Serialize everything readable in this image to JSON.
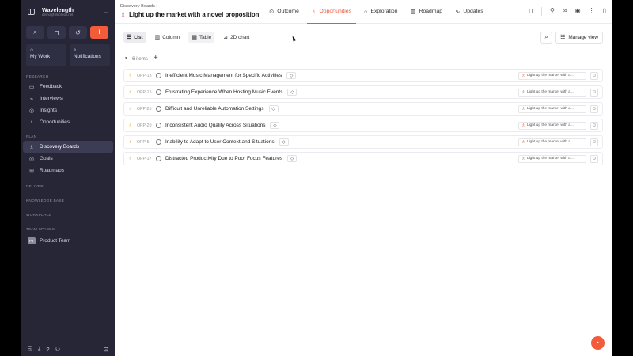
{
  "workspace": {
    "name": "Wavelength",
    "email": "demo@timbreoll.net"
  },
  "sidebar": {
    "quick_icons": [
      "search-icon",
      "bookmark-icon",
      "history-icon",
      "plus-icon"
    ],
    "tiles": [
      {
        "label": "My Work",
        "icon": "inbox-icon"
      },
      {
        "label": "Notifications",
        "icon": "bell-icon"
      }
    ],
    "sections": {
      "research": "RESEARCH",
      "plan": "PLAN",
      "deliver": "DELIVER",
      "knowledge": "KNOWLEDGE BASE",
      "workplace": "WORKPLACE",
      "team": "TEAM SPACES"
    },
    "research_items": [
      "Feedback",
      "Interviews",
      "Insights",
      "Opportunities"
    ],
    "plan_items": [
      "Discovery Boards",
      "Goals",
      "Roadmaps"
    ],
    "team": {
      "badge": "PT",
      "name": "Product Team"
    }
  },
  "header": {
    "breadcrumb": "Discovery Boards",
    "title": "Light up the market with a novel proposition",
    "tabs": [
      "Outcome",
      "Opportunities",
      "Exploration",
      "Roadmap",
      "Updates"
    ],
    "active_tab": "Opportunities"
  },
  "toolbar": {
    "views": [
      "List",
      "Column",
      "Table",
      "2D chart"
    ],
    "active_view": "List",
    "manage_label": "Manage view"
  },
  "group": {
    "count_label": "6 items"
  },
  "items": [
    {
      "id": "OPP-13",
      "title": "Inefficient Music Management for Specific Activities",
      "board": "Light up the market with a..."
    },
    {
      "id": "OPP-15",
      "title": "Frustrating Experience When Hosting Music Events",
      "board": "Light up the market with a..."
    },
    {
      "id": "OPP-25",
      "title": "Difficult and Unreliable Automation Settings",
      "board": "Light up the market with a..."
    },
    {
      "id": "OPP-20",
      "title": "Inconsistent Audio Quality Across Situations",
      "board": "Light up the market with a..."
    },
    {
      "id": "OPP-5",
      "title": "Inability to Adapt to User Context and Situations",
      "board": "Light up the market with a..."
    },
    {
      "id": "OPP-17",
      "title": "Distracted Productivity Due to Poor Focus Features",
      "board": "Light up the market with a..."
    }
  ],
  "colors": {
    "accent": "#e8553a",
    "sidebar_bg": "#262636",
    "brand_button": "#f25c3b"
  }
}
